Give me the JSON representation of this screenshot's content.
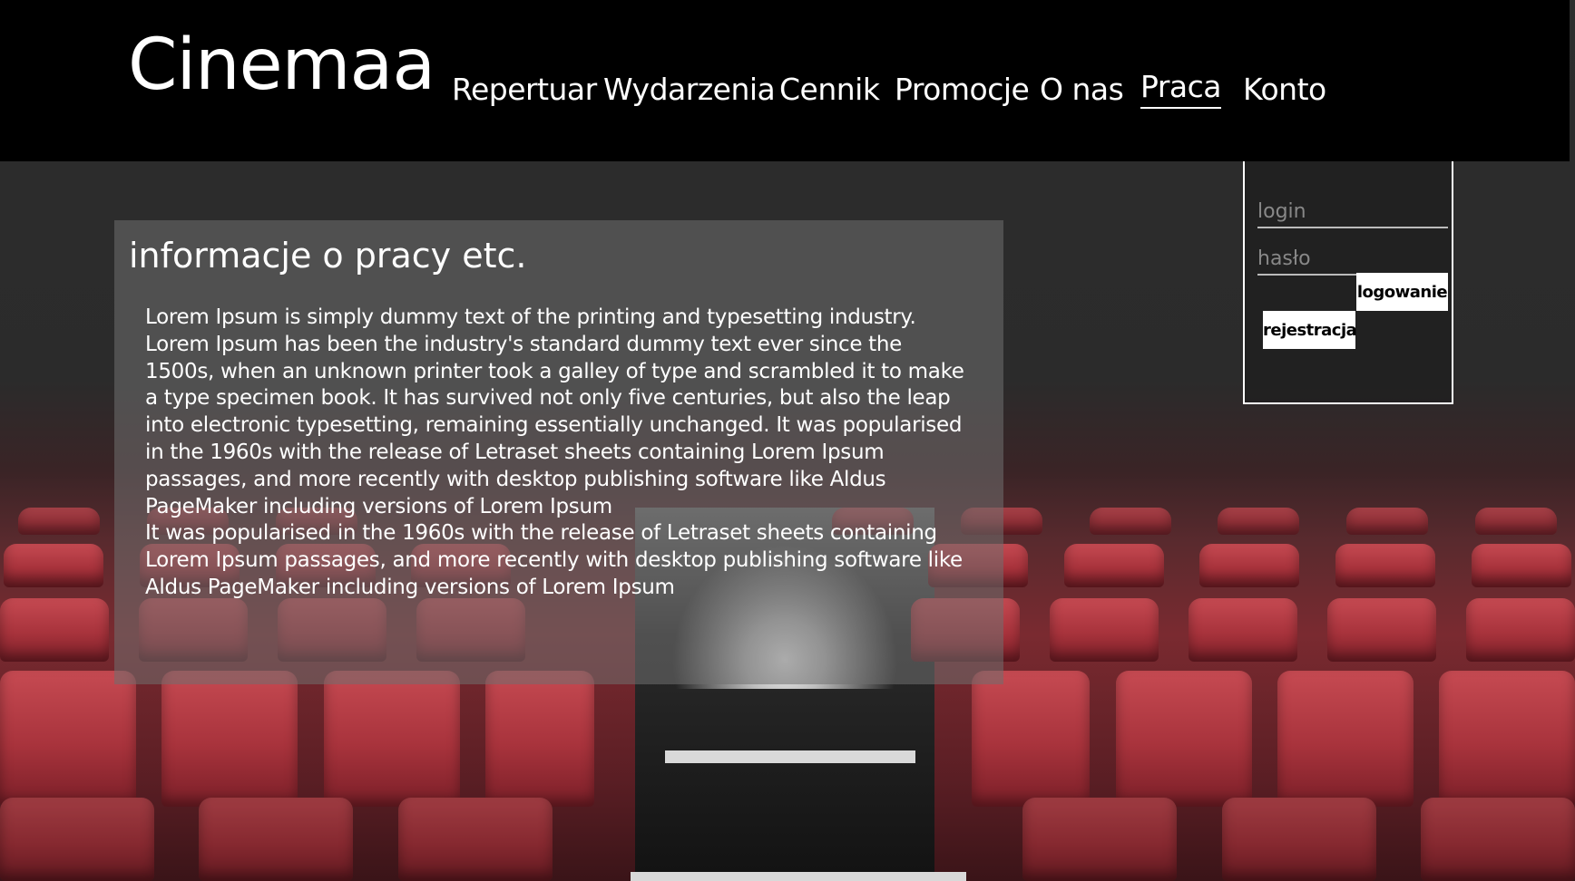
{
  "header": {
    "logo": "Cinemaa",
    "nav": [
      {
        "label": "Repertuar"
      },
      {
        "label": "Wydarzenia"
      },
      {
        "label": "Cennik"
      },
      {
        "label": "Promocje"
      },
      {
        "label": "O nas"
      },
      {
        "label": "Praca",
        "active": true
      },
      {
        "label": "Konto"
      }
    ]
  },
  "main": {
    "title": "informacje o pracy etc.",
    "paragraphs": [
      "Lorem Ipsum is simply dummy text of the printing and typesetting industry. Lorem Ipsum has been the industry's standard dummy text ever since the 1500s, when an unknown printer took a galley of type and scrambled it to make a type specimen book. It has survived not only five centuries, but also the leap into electronic typesetting, remaining essentially unchanged. It was popularised in the 1960s with the release of Letraset sheets containing Lorem Ipsum passages, and more recently with desktop publishing software like Aldus PageMaker including versions of Lorem Ipsum",
      "It was popularised in the 1960s with the release of Letraset sheets containing Lorem Ipsum passages, and more recently with desktop publishing software like Aldus PageMaker including versions of Lorem Ipsum"
    ]
  },
  "login": {
    "login_placeholder": "login",
    "password_placeholder": "hasło",
    "login_button": "logowanie",
    "register_button": "rejestracja"
  },
  "colors": {
    "header_bg": "#000000",
    "text": "#ffffff",
    "seat_red": "#b03a44"
  }
}
